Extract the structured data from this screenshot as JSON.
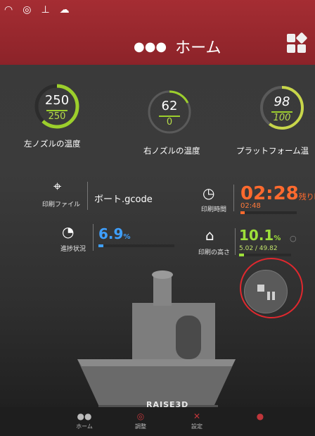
{
  "status_icons": [
    "wifi-icon",
    "webcam-icon",
    "filament-icon",
    "cloud-icon"
  ],
  "header": {
    "title": "ホーム",
    "icon": "users-icon"
  },
  "gauges": [
    {
      "current": "250",
      "target": "250",
      "label": "左ノズルの温度",
      "fraction": 0.62
    },
    {
      "current": "62",
      "target": "0",
      "label": "右ノズルの温度",
      "fraction": 0.18
    },
    {
      "current": "98",
      "target": "100",
      "label": "プラットフォーム温",
      "fraction": 0.6
    }
  ],
  "job": {
    "file_label": "印刷ファイル",
    "file_name": "ボート.gcode",
    "time_label": "印刷時間",
    "time_remaining": "02:28",
    "time_remaining_suffix": "残り時",
    "time_elapsed": "02:48",
    "progress_label": "進捗状況",
    "progress_value": "6.9",
    "progress_unit": "%",
    "progress_fraction": 0.069,
    "height_label": "印刷の高さ",
    "height_value": "10.1",
    "height_unit": "%",
    "height_detail": "5.02 / 49.82",
    "height_fraction": 0.101
  },
  "brand": "RAISE3D",
  "nav": [
    {
      "label": "ホーム",
      "icon": "users-icon"
    },
    {
      "label": "調整",
      "icon": "adjust-icon"
    },
    {
      "label": "設定",
      "icon": "tools-icon"
    },
    {
      "label": "",
      "icon": "more-icon"
    }
  ],
  "colors": {
    "header_red": "#9b2a30",
    "gauge_green": "#9ccf2c",
    "time_orange": "#ff6a2e",
    "progress_blue": "#3fa0ff",
    "height_green": "#9ee03a",
    "annotation_red": "#e0282e"
  }
}
